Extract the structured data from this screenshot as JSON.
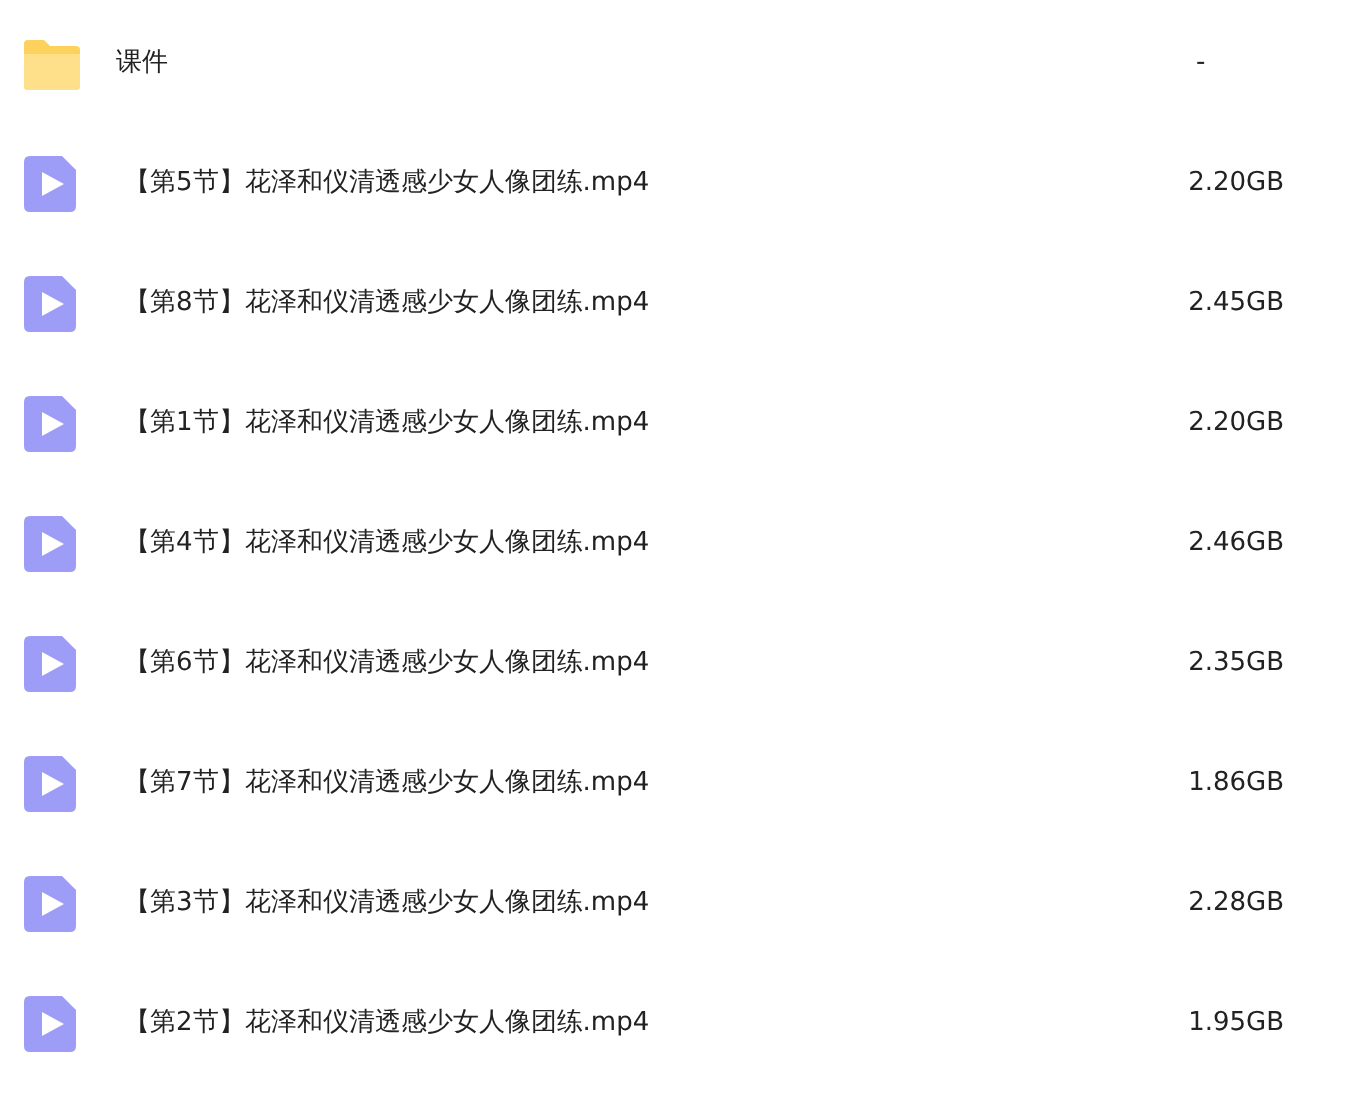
{
  "files": [
    {
      "kind": "folder",
      "name": "课件",
      "size": "-"
    },
    {
      "kind": "video",
      "name": "【第5节】花泽和仪清透感少女人像团练.mp4",
      "size": "2.20GB"
    },
    {
      "kind": "video",
      "name": "【第8节】花泽和仪清透感少女人像团练.mp4",
      "size": "2.45GB"
    },
    {
      "kind": "video",
      "name": "【第1节】花泽和仪清透感少女人像团练.mp4",
      "size": "2.20GB"
    },
    {
      "kind": "video",
      "name": "【第4节】花泽和仪清透感少女人像团练.mp4",
      "size": "2.46GB"
    },
    {
      "kind": "video",
      "name": "【第6节】花泽和仪清透感少女人像团练.mp4",
      "size": "2.35GB"
    },
    {
      "kind": "video",
      "name": "【第7节】花泽和仪清透感少女人像团练.mp4",
      "size": "1.86GB"
    },
    {
      "kind": "video",
      "name": "【第3节】花泽和仪清透感少女人像团练.mp4",
      "size": "2.28GB"
    },
    {
      "kind": "video",
      "name": "【第2节】花泽和仪清透感少女人像团练.mp4",
      "size": "1.95GB"
    }
  ]
}
